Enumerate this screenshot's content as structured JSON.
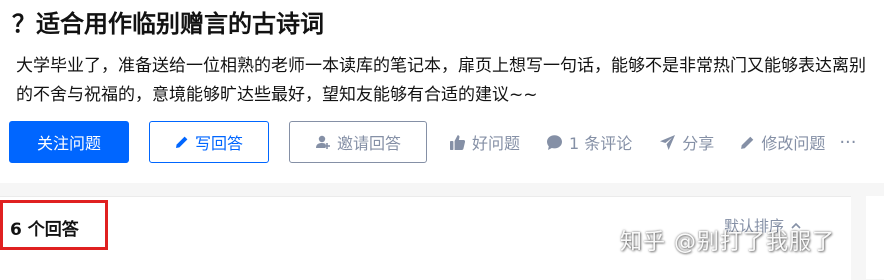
{
  "question": {
    "title_prefix": "？",
    "title": "适合用作临别赠言的古诗词",
    "description": "大学毕业了，准备送给一位相熟的老师一本读库的笔记本，扉页上想写一句话，能够不是非常热门又能够表达离别的不舍与祝福的，意境能够旷达些最好，望知友能够有合适的建议~~"
  },
  "actions": {
    "follow_label": "关注问题",
    "write_label": "写回答",
    "invite_label": "邀请回答",
    "like_label": "好问题",
    "comment_label": "1 条评论",
    "share_label": "分享",
    "edit_label": "修改问题",
    "more_label": "···"
  },
  "answers": {
    "count_label": "6 个回答",
    "sort_label": "默认排序"
  },
  "watermark": "知乎 @别打了我服了",
  "colors": {
    "brand_blue": "#0066ff",
    "muted_gray": "#8590a6",
    "highlight_red": "#e02020"
  }
}
